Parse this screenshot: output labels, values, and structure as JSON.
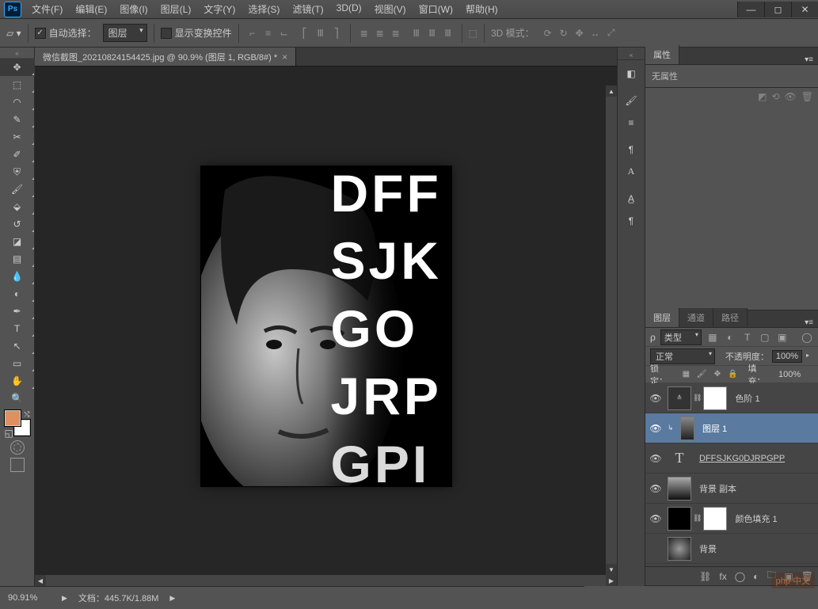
{
  "app": {
    "logo_text": "Ps"
  },
  "menu": {
    "file": "文件(F)",
    "edit": "编辑(E)",
    "image": "图像(I)",
    "layer": "图层(L)",
    "type": "文字(Y)",
    "select": "选择(S)",
    "filter": "滤镜(T)",
    "threeD": "3D(D)",
    "view": "视图(V)",
    "window": "窗口(W)",
    "help": "帮助(H)"
  },
  "options": {
    "auto_select_label": "自动选择：",
    "auto_select_target": "图层",
    "show_transform_label": "显示变换控件",
    "threeD_mode_label": "3D 模式："
  },
  "document": {
    "tab_title": "微信截图_20210824154425.jpg @ 90.9% (图层 1, RGB/8#) *"
  },
  "artwork": {
    "rows": [
      "DFF",
      "SJK",
      "GO",
      "JRP",
      "GPI"
    ]
  },
  "panels": {
    "properties_tab": "属性",
    "properties_none": "无属性",
    "layers_tab": "图层",
    "channels_tab": "通道",
    "paths_tab": "路径"
  },
  "layers": {
    "filter_kind": "类型",
    "blend_mode": "正常",
    "opacity_label": "不透明度：",
    "opacity_value": "100%",
    "lock_label": "锁定：",
    "fill_label": "填充：",
    "fill_value": "100%",
    "items": [
      {
        "name": "色阶 1",
        "kind": "adj-levels"
      },
      {
        "name": "图层 1",
        "kind": "clipped-image",
        "selected": true
      },
      {
        "name": "DFFSJKG0DJRPGPP",
        "kind": "text"
      },
      {
        "name": "背景 副本",
        "kind": "image"
      },
      {
        "name": "颜色填充 1",
        "kind": "adj-fill"
      },
      {
        "name": "背景",
        "kind": "bg"
      }
    ]
  },
  "search": {
    "placeholder": "ρ"
  },
  "status": {
    "zoom": "90.91%",
    "doc_info": "文档：445.7K/1.88M"
  },
  "watermark": "php 中文"
}
